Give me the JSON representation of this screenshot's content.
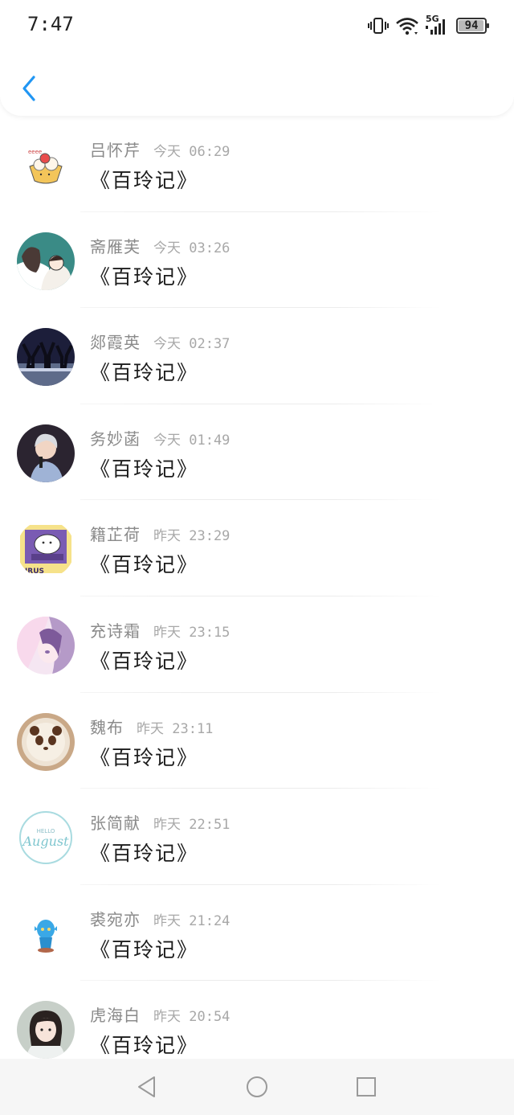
{
  "status_bar": {
    "time": "7:47",
    "network": "5G",
    "battery": "94"
  },
  "header": {
    "back_icon": "chevron-left-icon",
    "accent_color": "#2196f3"
  },
  "messages": [
    {
      "name": "吕怀芹",
      "time": "今天 06:29",
      "text": "《百玲记》",
      "avatar": "dessert-sticker"
    },
    {
      "name": "斋雁芙",
      "time": "今天 03:26",
      "text": "《百玲记》",
      "avatar": "illustrated-couple"
    },
    {
      "name": "郯霞英",
      "time": "今天 02:37",
      "text": "《百玲记》",
      "avatar": "stage-dancers"
    },
    {
      "name": "务妙菡",
      "time": "今天 01:49",
      "text": "《百玲记》",
      "avatar": "singer-portrait"
    },
    {
      "name": "籍芷荷",
      "time": "昨天 23:29",
      "text": "《百玲记》",
      "avatar": "taurus-cartoon"
    },
    {
      "name": "充诗霜",
      "time": "昨天 23:15",
      "text": "《百玲记》",
      "avatar": "anime-girl"
    },
    {
      "name": "魏布",
      "time": "昨天 23:11",
      "text": "《百玲记》",
      "avatar": "panda-latte"
    },
    {
      "name": "张简献",
      "time": "昨天 22:51",
      "text": "《百玲记》",
      "avatar": "hello-august",
      "avatar_text_1": "HELLO",
      "avatar_text_2": "August"
    },
    {
      "name": "裘宛亦",
      "time": "昨天 21:24",
      "text": "《百玲记》",
      "avatar": "blue-figurine"
    },
    {
      "name": "虎海白",
      "time": "昨天 20:54",
      "text": "《百玲记》",
      "avatar": "girl-portrait"
    }
  ],
  "nav_bar": {
    "back": "triangle-back-icon",
    "home": "circle-home-icon",
    "recents": "square-recents-icon"
  }
}
